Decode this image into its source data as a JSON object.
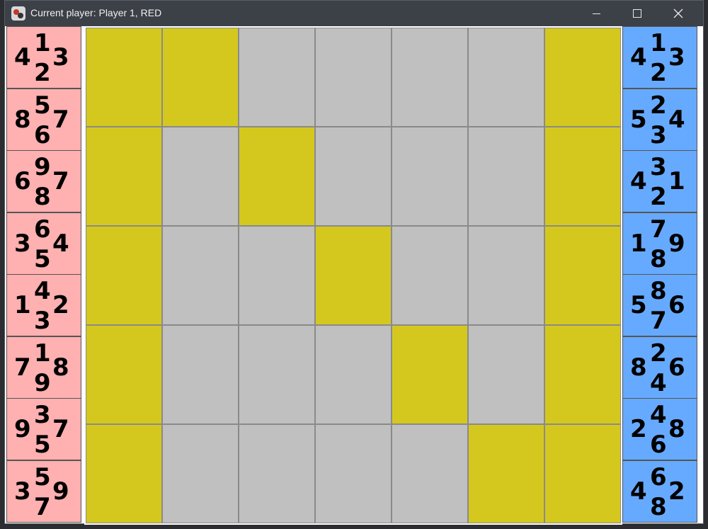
{
  "window": {
    "title": "Current player: Player 1, RED",
    "controls": [
      "minimize",
      "maximize",
      "close"
    ]
  },
  "red_hand": {
    "color": "#ffb0b0",
    "cards": [
      {
        "top": "1",
        "left": "4",
        "right": "3",
        "bottom": "2"
      },
      {
        "top": "5",
        "left": "8",
        "right": "7",
        "bottom": "6"
      },
      {
        "top": "9",
        "left": "6",
        "right": "7",
        "bottom": "8"
      },
      {
        "top": "6",
        "left": "3",
        "right": "4",
        "bottom": "5"
      },
      {
        "top": "4",
        "left": "1",
        "right": "2",
        "bottom": "3"
      },
      {
        "top": "1",
        "left": "7",
        "right": "8",
        "bottom": "9"
      },
      {
        "top": "3",
        "left": "9",
        "right": "7",
        "bottom": "5"
      },
      {
        "top": "5",
        "left": "3",
        "right": "9",
        "bottom": "7"
      }
    ]
  },
  "blue_hand": {
    "color": "#66aaff",
    "cards": [
      {
        "top": "1",
        "left": "4",
        "right": "3",
        "bottom": "2"
      },
      {
        "top": "2",
        "left": "5",
        "right": "4",
        "bottom": "3"
      },
      {
        "top": "3",
        "left": "4",
        "right": "1",
        "bottom": "2"
      },
      {
        "top": "7",
        "left": "1",
        "right": "9",
        "bottom": "8"
      },
      {
        "top": "8",
        "left": "5",
        "right": "6",
        "bottom": "7"
      },
      {
        "top": "2",
        "left": "8",
        "right": "6",
        "bottom": "4"
      },
      {
        "top": "4",
        "left": "2",
        "right": "8",
        "bottom": "6"
      },
      {
        "top": "6",
        "left": "4",
        "right": "2",
        "bottom": "8"
      }
    ]
  },
  "board": {
    "rows": 5,
    "cols": 7,
    "colors": {
      "empty": "#c0c0c0",
      "yellow": "#d4c81f"
    },
    "cells": [
      [
        "yellow",
        "yellow",
        "empty",
        "empty",
        "empty",
        "empty",
        "yellow"
      ],
      [
        "yellow",
        "empty",
        "yellow",
        "empty",
        "empty",
        "empty",
        "yellow"
      ],
      [
        "yellow",
        "empty",
        "empty",
        "yellow",
        "empty",
        "empty",
        "yellow"
      ],
      [
        "yellow",
        "empty",
        "empty",
        "empty",
        "yellow",
        "empty",
        "yellow"
      ],
      [
        "yellow",
        "empty",
        "empty",
        "empty",
        "empty",
        "yellow",
        "yellow"
      ]
    ]
  }
}
